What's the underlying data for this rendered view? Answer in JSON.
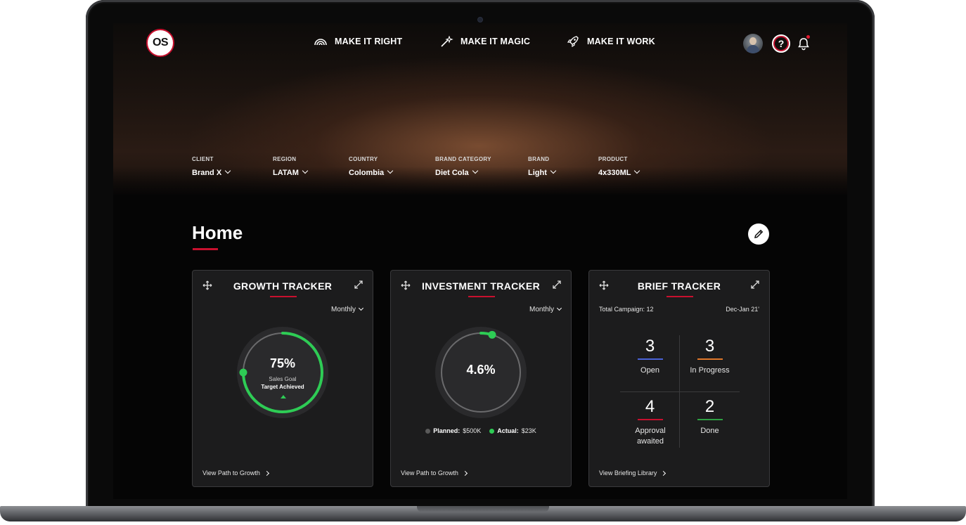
{
  "nav": {
    "logo_text": "OS",
    "items": [
      {
        "label": "MAKE IT RIGHT",
        "icon": "rainbow-icon"
      },
      {
        "label": "MAKE IT MAGIC",
        "icon": "magic-wand-icon"
      },
      {
        "label": "MAKE IT WORK",
        "icon": "rocket-icon"
      }
    ],
    "help_label": "?"
  },
  "filters": [
    {
      "label": "CLIENT",
      "value": "Brand X"
    },
    {
      "label": "REGION",
      "value": "LATAM"
    },
    {
      "label": "COUNTRY",
      "value": "Colombia"
    },
    {
      "label": "BRAND CATEGORY",
      "value": "Diet Cola"
    },
    {
      "label": "BRAND",
      "value": "Light"
    },
    {
      "label": "PRODUCT",
      "value": "4x330ML"
    }
  ],
  "home": {
    "title": "Home"
  },
  "growth": {
    "title": "GROWTH TRACKER",
    "period": "Monthly",
    "value_label": "75%",
    "value": 0.75,
    "sub1": "Sales Goal",
    "sub2": "Target Achieved",
    "link": "View Path to Growth"
  },
  "investment": {
    "title": "INVESTMENT TRACKER",
    "period": "Monthly",
    "value_label": "4.6%",
    "value": 0.046,
    "planned_label": "Planned:",
    "planned_value": "$500K",
    "actual_label": "Actual:",
    "actual_value": "$23K",
    "link": "View Path to Growth"
  },
  "brief": {
    "title": "BRIEF TRACKER",
    "total": "Total Campaign: 12",
    "date_range": "Dec-Jan 21'",
    "stats": [
      {
        "num": "3",
        "label": "Open",
        "color": "#4a63d8"
      },
      {
        "num": "3",
        "label": "In Progress",
        "color": "#e0782b"
      },
      {
        "num": "4",
        "label": "Approval awaited",
        "color": "#c8102e"
      },
      {
        "num": "2",
        "label": "Done",
        "color": "#2ea043"
      }
    ],
    "link": "View Briefing Library"
  },
  "colors": {
    "accent": "#c8102e",
    "success": "#2ecc55",
    "planned": "#5a5a5a"
  }
}
